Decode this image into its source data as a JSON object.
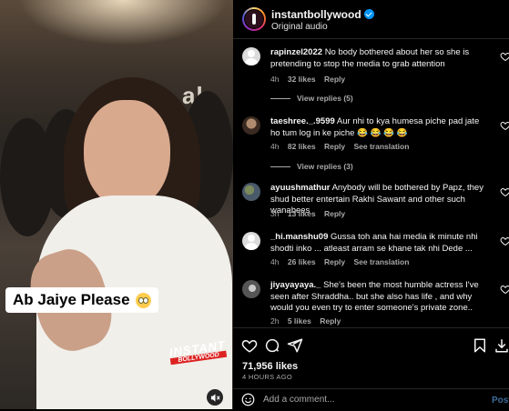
{
  "media": {
    "caption_text": "Ab Jaiye Please",
    "watermark_line1": "INSTANT",
    "watermark_line2": "BOLLYWOOD"
  },
  "header": {
    "username": "instantbollywood",
    "audio": "Original audio"
  },
  "comments": [
    {
      "username": "rapinzel2022",
      "text": "No body bothered about her so she is pretending to stop the media to grab attention",
      "time": "4h",
      "likes": "32 likes",
      "reply": "Reply",
      "view_replies": "View replies (5)"
    },
    {
      "username": "taeshree._.9599",
      "text": "Aur nhi to kya humesa piche pad jate ho tum log in ke piche 😂 😂 😂 😂",
      "time": "4h",
      "likes": "82 likes",
      "reply": "Reply",
      "see_translation": "See translation",
      "view_replies": "View replies (3)"
    },
    {
      "username": "ayuushmathur",
      "text": "Anybody will be bothered by Papz, they shud better entertain Rakhi Sawant and other such wanabees",
      "time": "3h",
      "likes": "13 likes",
      "reply": "Reply"
    },
    {
      "username": "_hi.manshu09",
      "text": "Gussa toh ana hai media ik minute nhi shodti inko ... atleast arram se khane tak nhi Dede ...",
      "time": "4h",
      "likes": "26 likes",
      "reply": "Reply",
      "see_translation": "See translation"
    },
    {
      "username": "jiyayayaya._",
      "text": "She's been the most humble actress I've seen after Shraddha.. but she also has life , and why would you even try to enter someone's private zone..",
      "time": "2h",
      "likes": "5 likes",
      "reply": "Reply"
    }
  ],
  "footer": {
    "likes_count": "71,956 likes",
    "posted_ago": "4 HOURS AGO",
    "add_comment_placeholder": "Add a comment...",
    "post_label": "Post"
  },
  "colors": {
    "background": "#000000",
    "verified": "#0095f6",
    "muted_text": "#a8a8a8",
    "post_button": "#3f6c9a"
  }
}
